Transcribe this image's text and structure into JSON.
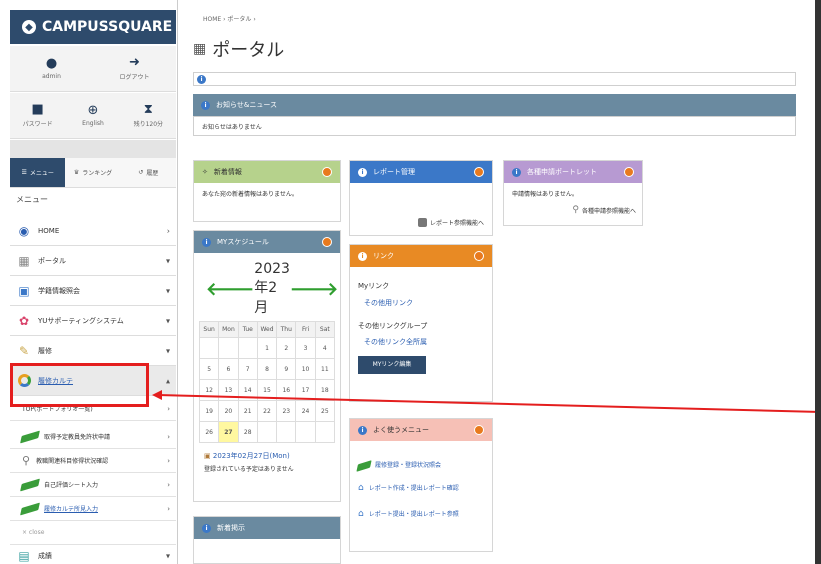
{
  "sidebar": {
    "brand": "CAMPUSSQUARE",
    "util1": [
      {
        "icon": "user-icon",
        "label": "admin"
      },
      {
        "icon": "logout-icon",
        "label": "ログアウト"
      }
    ],
    "util2": [
      {
        "icon": "lock-icon",
        "label": "パスワード"
      },
      {
        "icon": "globe-icon",
        "label": "English"
      },
      {
        "icon": "hourglass-icon",
        "label": "残り120分"
      }
    ],
    "tabs": [
      "メニュー",
      "ランキング",
      "履歴"
    ],
    "menu_label": "メニュー",
    "items": [
      {
        "label": "HOME"
      },
      {
        "label": "ポータル"
      },
      {
        "label": "学籍情報照会"
      },
      {
        "label": "YUサポーティングシステム"
      },
      {
        "label": "履修"
      },
      {
        "label": "履修カルテ"
      }
    ],
    "subitems": [
      {
        "label": "TOP(ポートフォリオ一覧)"
      },
      {
        "label": "取得予定教員免許状申請"
      },
      {
        "label": "教職関連科目修得状況確認"
      },
      {
        "label": "自己評価シート入力"
      },
      {
        "label": "履修カルテ所見入力"
      }
    ],
    "close_label": "× close",
    "last_item": "成績"
  },
  "main": {
    "breadcrumb": "HOME › ポータル ›",
    "title": "ポータル",
    "news_title": "お知らせ&ニュース",
    "news_body": "お知らせはありません",
    "cards": {
      "new_info": {
        "title": "新着情報",
        "body": "あなた宛の新着情報はありません。",
        "color": "#b6d28c"
      },
      "schedule": {
        "title": "MYスケジュール",
        "color": "#6a8aa0",
        "month": "2023年2月",
        "weekdays": [
          "Sun",
          "Mon",
          "Tue",
          "Wed",
          "Thu",
          "Fri",
          "Sat"
        ],
        "weeks": [
          [
            "",
            "",
            "",
            "1",
            "2",
            "3",
            "4"
          ],
          [
            "5",
            "6",
            "7",
            "8",
            "9",
            "10",
            "11"
          ],
          [
            "12",
            "13",
            "14",
            "15",
            "16",
            "17",
            "18"
          ],
          [
            "19",
            "20",
            "21",
            "22",
            "23",
            "24",
            "25"
          ],
          [
            "26",
            "27",
            "28",
            "",
            "",
            "",
            ""
          ]
        ],
        "date_label": "2023年02月27日(Mon)",
        "no_plan": "登録されている予定はありません"
      },
      "new_board": {
        "title": "新着掲示"
      },
      "report": {
        "title": "レポート管理",
        "link": "レポート参照機能へ",
        "color": "#3b78c8"
      },
      "link": {
        "title": "リンク",
        "color": "#e88a24",
        "my_link": "Myリンク",
        "other": "その他用リンク",
        "group": "その他リンクグループ",
        "group_link": "その他リンク全所属",
        "button": "MYリンク編集"
      },
      "favorite": {
        "title": "よく使うメニュー",
        "color": "#f6c0b6",
        "items": [
          "履修登録・登録状況照会",
          "レポート作成・提出レポート確認",
          "レポート提出・提出レポート参照"
        ]
      },
      "portlet": {
        "title": "各種申請ポートレット",
        "color": "#b79ad2",
        "body": "申請情報はありません。",
        "link": "各種申請参照機能へ"
      }
    }
  }
}
